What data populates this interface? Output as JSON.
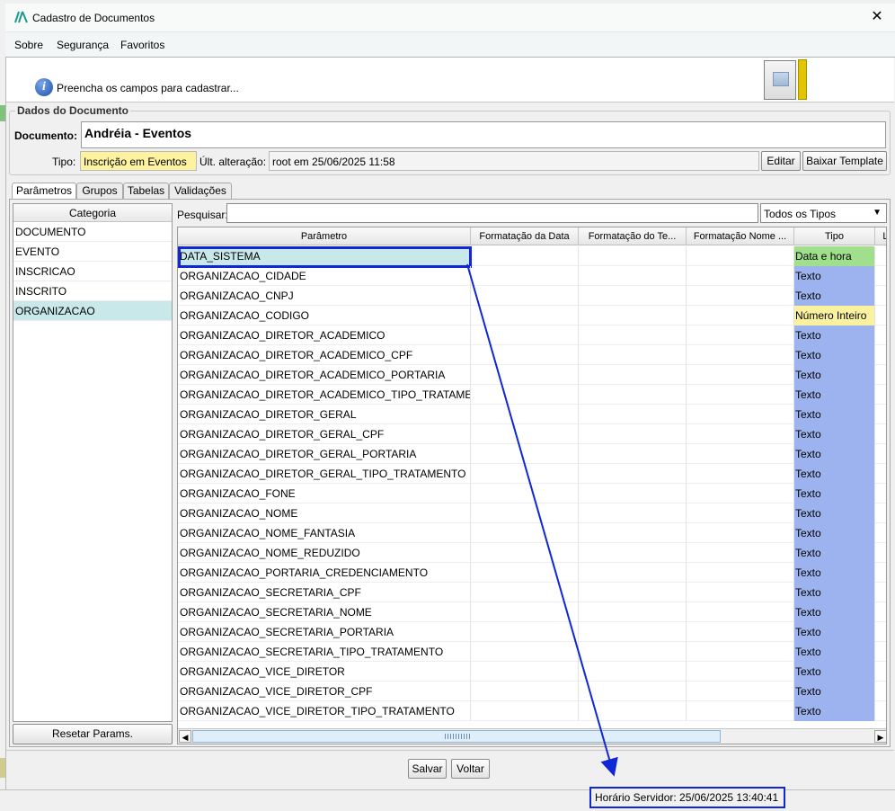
{
  "window": {
    "title": "Cadastro de Documentos"
  },
  "menu": {
    "sobre": "Sobre",
    "seguranca": "Segurança",
    "favoritos": "Favoritos"
  },
  "message": {
    "text": "Preencha os campos para cadastrar..."
  },
  "dados": {
    "legend": "Dados do Documento",
    "documento_label": "Documento:",
    "documento_value": "Andréia - Eventos",
    "tipo_label": "Tipo:",
    "tipo_value": "Inscrição em Eventos",
    "alteracao_label": "Últ. alteração:",
    "alteracao_value": "root em 25/06/2025 11:58",
    "editar": "Editar",
    "baixar_template": "Baixar Template"
  },
  "tabs": [
    "Parâmetros",
    "Grupos",
    "Tabelas",
    "Validações"
  ],
  "categories": {
    "header": "Categoria",
    "items": [
      "DOCUMENTO",
      "EVENTO",
      "INSCRICAO",
      "INSCRITO",
      "ORGANIZACAO"
    ],
    "selected_index": 4,
    "reset_label": "Resetar Params."
  },
  "search": {
    "label": "Pesquisar:",
    "filter_value": "Todos os Tipos"
  },
  "table": {
    "columns": [
      "Parâmetro",
      "Formatação da Data",
      "Formatação do Te...",
      "Formatação Nome ...",
      "Tipo",
      "La"
    ],
    "rows": [
      [
        "DATA_SISTEMA",
        "Data e hora"
      ],
      [
        "ORGANIZACAO_CIDADE",
        "Texto"
      ],
      [
        "ORGANIZACAO_CNPJ",
        "Texto"
      ],
      [
        "ORGANIZACAO_CODIGO",
        "Número Inteiro"
      ],
      [
        "ORGANIZACAO_DIRETOR_ACADEMICO",
        "Texto"
      ],
      [
        "ORGANIZACAO_DIRETOR_ACADEMICO_CPF",
        "Texto"
      ],
      [
        "ORGANIZACAO_DIRETOR_ACADEMICO_PORTARIA",
        "Texto"
      ],
      [
        "ORGANIZACAO_DIRETOR_ACADEMICO_TIPO_TRATAMENTO",
        "Texto"
      ],
      [
        "ORGANIZACAO_DIRETOR_GERAL",
        "Texto"
      ],
      [
        "ORGANIZACAO_DIRETOR_GERAL_CPF",
        "Texto"
      ],
      [
        "ORGANIZACAO_DIRETOR_GERAL_PORTARIA",
        "Texto"
      ],
      [
        "ORGANIZACAO_DIRETOR_GERAL_TIPO_TRATAMENTO",
        "Texto"
      ],
      [
        "ORGANIZACAO_FONE",
        "Texto"
      ],
      [
        "ORGANIZACAO_NOME",
        "Texto"
      ],
      [
        "ORGANIZACAO_NOME_FANTASIA",
        "Texto"
      ],
      [
        "ORGANIZACAO_NOME_REDUZIDO",
        "Texto"
      ],
      [
        "ORGANIZACAO_PORTARIA_CREDENCIAMENTO",
        "Texto"
      ],
      [
        "ORGANIZACAO_SECRETARIA_CPF",
        "Texto"
      ],
      [
        "ORGANIZACAO_SECRETARIA_NOME",
        "Texto"
      ],
      [
        "ORGANIZACAO_SECRETARIA_PORTARIA",
        "Texto"
      ],
      [
        "ORGANIZACAO_SECRETARIA_TIPO_TRATAMENTO",
        "Texto"
      ],
      [
        "ORGANIZACAO_VICE_DIRETOR",
        "Texto"
      ],
      [
        "ORGANIZACAO_VICE_DIRETOR_CPF",
        "Texto"
      ],
      [
        "ORGANIZACAO_VICE_DIRETOR_TIPO_TRATAMENTO",
        "Texto"
      ]
    ],
    "selected_index": 0,
    "type_colors": {
      "Texto": "#9db3f0",
      "Data e hora": "#a0e08c",
      "Número Inteiro": "#fbf2a0"
    }
  },
  "buttons": {
    "salvar": "Salvar",
    "voltar": "Voltar"
  },
  "status": {
    "server_time": "Horário Servidor: 25/06/2025 13:40:41"
  },
  "colors": {
    "annotation": "#1027d8",
    "selection": "#c9e8e9",
    "tipo_yellow": "#fcf2a0"
  }
}
